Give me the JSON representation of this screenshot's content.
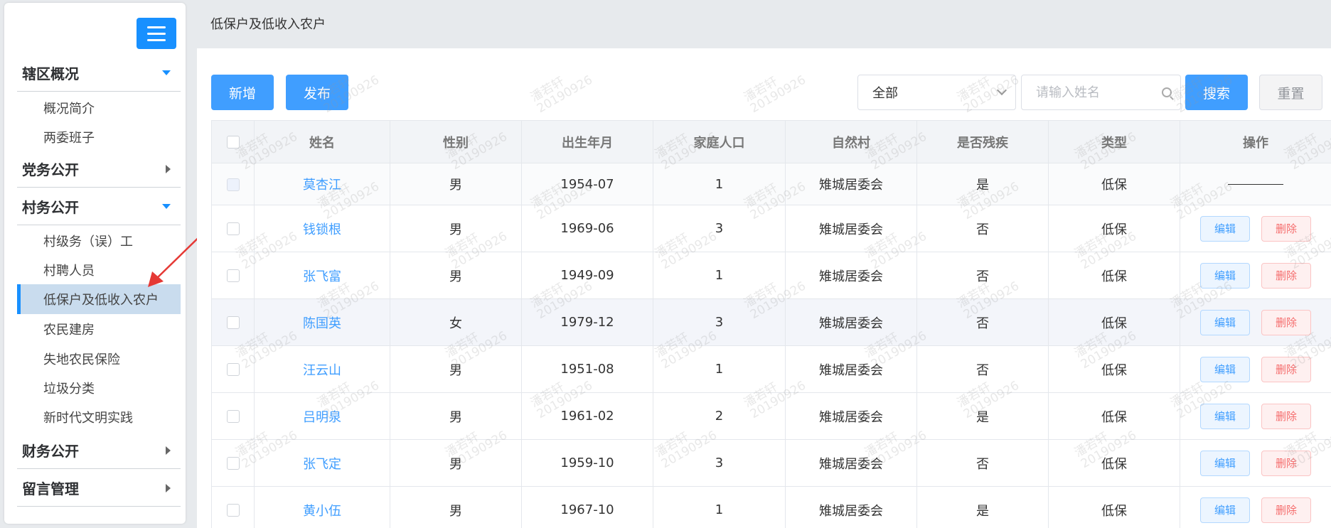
{
  "header": {
    "title": "低保户及低收入农户"
  },
  "sidebar": {
    "menu_icon": "hamburger-icon",
    "groups": [
      {
        "label": "辖区概况",
        "expanded": true,
        "items": [
          "概况简介",
          "两委班子"
        ]
      },
      {
        "label": "党务公开",
        "expanded": false
      },
      {
        "label": "村务公开",
        "expanded": true,
        "items": [
          "村级务（误）工",
          "村聘人员",
          "低保户及低收入农户",
          "农民建房",
          "失地农民保险",
          "垃圾分类",
          "新时代文明实践"
        ],
        "active_item": "低保户及低收入农户"
      },
      {
        "label": "财务公开",
        "expanded": false
      },
      {
        "label": "留言管理",
        "expanded": false
      }
    ]
  },
  "toolbar": {
    "add_label": "新增",
    "publish_label": "发布",
    "filter_value": "全部",
    "search_placeholder": "请输入姓名",
    "search_label": "搜索",
    "reset_label": "重置"
  },
  "table": {
    "headers": [
      "姓名",
      "性别",
      "出生年月",
      "家庭人口",
      "自然村",
      "是否残疾",
      "类型",
      "操作"
    ],
    "rows": [
      {
        "name": "莫杏江",
        "gender": "男",
        "birth": "1954-07",
        "family": "1",
        "village": "雉城居委会",
        "disabled": "是",
        "type": "低保"
      },
      {
        "name": "钱锁根",
        "gender": "男",
        "birth": "1969-06",
        "family": "3",
        "village": "雉城居委会",
        "disabled": "否",
        "type": "低保"
      },
      {
        "name": "张飞富",
        "gender": "男",
        "birth": "1949-09",
        "family": "1",
        "village": "雉城居委会",
        "disabled": "否",
        "type": "低保"
      },
      {
        "name": "陈国英",
        "gender": "女",
        "birth": "1979-12",
        "family": "3",
        "village": "雉城居委会",
        "disabled": "否",
        "type": "低保"
      },
      {
        "name": "汪云山",
        "gender": "男",
        "birth": "1951-08",
        "family": "1",
        "village": "雉城居委会",
        "disabled": "否",
        "type": "低保"
      },
      {
        "name": "吕明泉",
        "gender": "男",
        "birth": "1961-02",
        "family": "2",
        "village": "雉城居委会",
        "disabled": "是",
        "type": "低保"
      },
      {
        "name": "张飞定",
        "gender": "男",
        "birth": "1959-10",
        "family": "3",
        "village": "雉城居委会",
        "disabled": "否",
        "type": "低保"
      },
      {
        "name": "黄小伍",
        "gender": "男",
        "birth": "1967-10",
        "family": "1",
        "village": "雉城居委会",
        "disabled": "是",
        "type": "低保"
      }
    ],
    "edit_label": "编辑",
    "delete_label": "删除"
  },
  "watermark": {
    "name": "潘若轩",
    "date": "20190926"
  },
  "colors": {
    "primary": "#409eff",
    "sidebar_accent": "#1890ff",
    "danger": "#f56c6c",
    "annotation_arrow": "#e53935"
  }
}
